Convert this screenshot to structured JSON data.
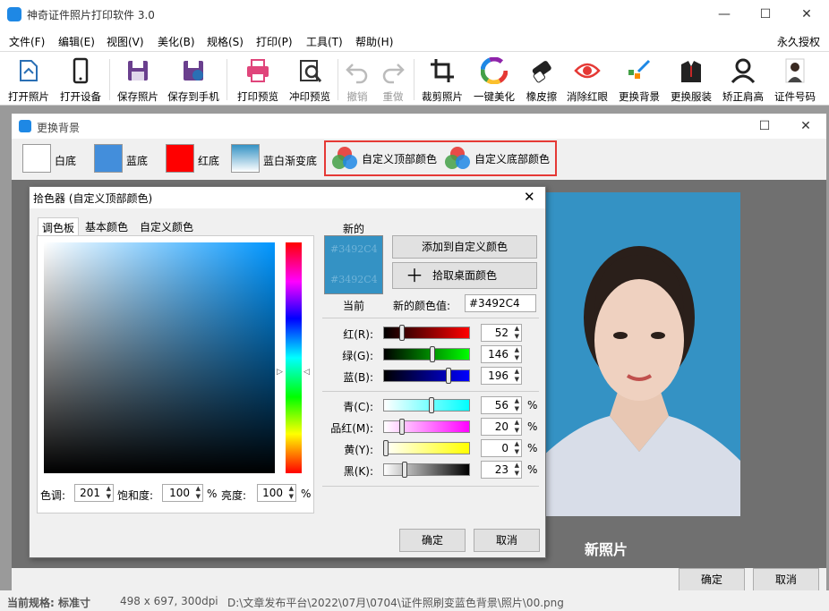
{
  "app": {
    "title": "神奇证件照片打印软件 3.0",
    "window_controls": {
      "minimize": "—",
      "maximize": "☐",
      "close": "✕"
    }
  },
  "menubar": {
    "items": [
      "文件(F)",
      "编辑(E)",
      "视图(V)",
      "美化(B)",
      "规格(S)",
      "打印(P)",
      "工具(T)",
      "帮助(H)"
    ],
    "license": "永久授权"
  },
  "toolbar": {
    "items": [
      {
        "label": "打开照片",
        "icon": "open-photo-icon"
      },
      {
        "label": "打开设备",
        "icon": "phone-device-icon"
      },
      {
        "label": "保存照片",
        "icon": "save-icon"
      },
      {
        "label": "保存到手机",
        "icon": "save-to-phone-icon"
      },
      {
        "label": "打印预览",
        "icon": "printer-icon"
      },
      {
        "label": "冲印预览",
        "icon": "print-preview-magnifier-icon"
      },
      {
        "label": "撤销",
        "icon": "undo-icon"
      },
      {
        "label": "重做",
        "icon": "redo-icon"
      },
      {
        "label": "裁剪照片",
        "icon": "crop-icon"
      },
      {
        "label": "一键美化",
        "icon": "color-wheel-icon"
      },
      {
        "label": "橡皮擦",
        "icon": "eraser-icon"
      },
      {
        "label": "消除红眼",
        "icon": "red-eye-icon"
      },
      {
        "label": "更换背景",
        "icon": "change-background-icon"
      },
      {
        "label": "更换服装",
        "icon": "suit-icon"
      },
      {
        "label": "矫正肩高",
        "icon": "shoulder-icon"
      },
      {
        "label": "证件号码",
        "icon": "id-photo-icon"
      }
    ]
  },
  "bg_dialog": {
    "title": "更换背景",
    "options": [
      {
        "label": "白底",
        "color": "#ffffff"
      },
      {
        "label": "蓝底",
        "color": "#438edb"
      },
      {
        "label": "红底",
        "color": "#ff0000"
      },
      {
        "label": "蓝白渐变底",
        "color": "#3492c4"
      }
    ],
    "custom_top": "自定义顶部颜色",
    "custom_bottom": "自定义底部颜色",
    "new_photo_label": "新照片",
    "ok": "确定",
    "cancel": "取消"
  },
  "picker": {
    "title": "拾色器 (自定义顶部颜色)",
    "tabs": [
      "调色板",
      "基本颜色",
      "自定义颜色"
    ],
    "new_label": "新的",
    "current_label": "当前",
    "new_hex_text": "#3492C4",
    "current_hex_text": "#3492C4",
    "add_custom": "添加到自定义颜色",
    "pick_desktop": "拾取桌面颜色",
    "new_value_label": "新的颜色值:",
    "new_value": "#3492C4",
    "hue_label": "色调:",
    "hue": "201",
    "sat_label": "饱和度:",
    "sat": "100",
    "bright_label": "亮度:",
    "bright": "100",
    "percent": "%",
    "rgb": [
      {
        "label": "红(R):",
        "value": "52",
        "level": 0.2
      },
      {
        "label": "绿(G):",
        "value": "146",
        "level": 0.57
      },
      {
        "label": "蓝(B):",
        "value": "196",
        "level": 0.77
      }
    ],
    "cmyk": [
      {
        "label": "青(C):",
        "value": "56",
        "level": 0.56
      },
      {
        "label": "品红(M):",
        "value": "20",
        "level": 0.2
      },
      {
        "label": "黄(Y):",
        "value": "0",
        "level": 0.0
      },
      {
        "label": "黑(K):",
        "value": "23",
        "level": 0.23
      }
    ],
    "ok": "确定",
    "cancel": "取消"
  },
  "status": {
    "spec": "当前规格: 标准寸",
    "size": "498 x 697, 300dpi",
    "path": "D:\\文章发布平台\\2022\\07月\\0704\\证件照刷变蓝色背景\\照片\\00.png"
  }
}
